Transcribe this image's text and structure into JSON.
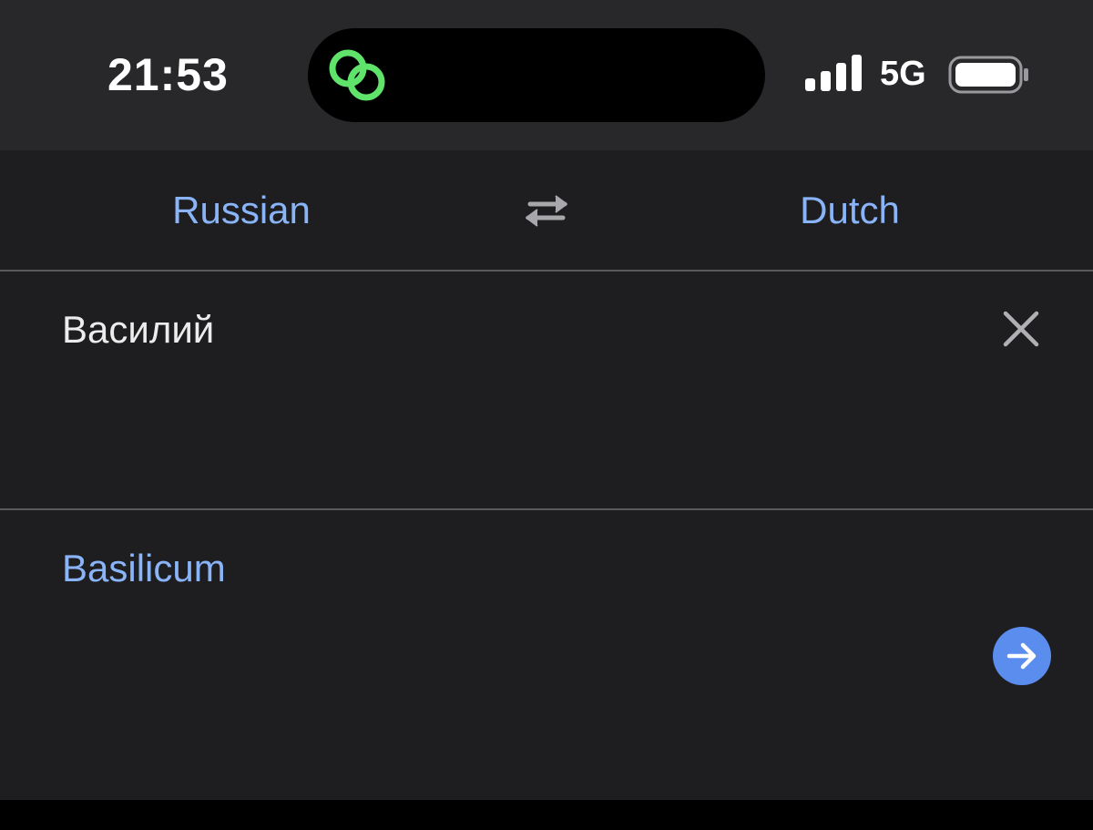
{
  "status_bar": {
    "time": "21:53",
    "network": "5G",
    "island_icon": "link-chain-icon",
    "signal_icon": "cellular-signal-icon",
    "battery_icon": "battery-icon",
    "island_icon_color": "#5fe36a"
  },
  "language_bar": {
    "source_language": "Russian",
    "target_language": "Dutch",
    "swap_icon": "swap-arrows-icon",
    "accent_color": "#8ab4f8"
  },
  "input": {
    "text": "Василий",
    "clear_icon": "close-icon"
  },
  "output": {
    "text": "Basilicum",
    "go_icon": "arrow-right-icon",
    "go_button_color": "#5b8def"
  }
}
